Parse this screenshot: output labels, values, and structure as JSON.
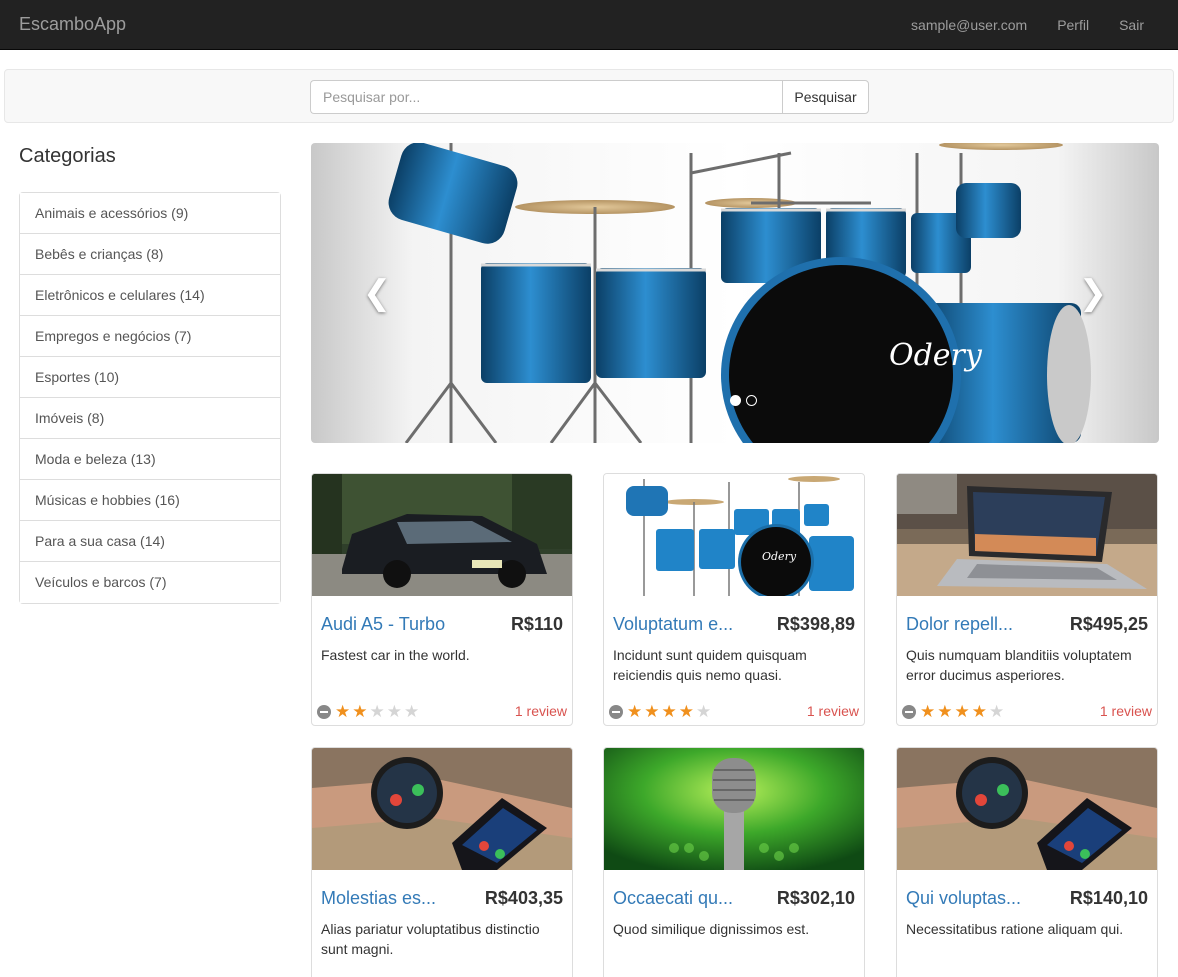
{
  "navbar": {
    "brand": "EscamboApp",
    "email": "sample@user.com",
    "profile": "Perfil",
    "logout": "Sair"
  },
  "search": {
    "placeholder": "Pesquisar por...",
    "value": "",
    "button": "Pesquisar"
  },
  "categories": {
    "title": "Categorias",
    "items": [
      {
        "label": "Animais e acessórios (9)"
      },
      {
        "label": "Bebês e crianças (8)"
      },
      {
        "label": "Eletrônicos e celulares (14)"
      },
      {
        "label": "Empregos e negócios (7)"
      },
      {
        "label": "Esportes (10)"
      },
      {
        "label": "Imóveis (8)"
      },
      {
        "label": "Moda e beleza (13)"
      },
      {
        "label": "Músicas e hobbies (16)"
      },
      {
        "label": "Para a sua casa (14)"
      },
      {
        "label": "Veículos e barcos (7)"
      }
    ]
  },
  "carousel": {
    "prev_icon": "chevron-left-icon",
    "next_icon": "chevron-right-icon",
    "slide_count": 2,
    "active_slide": 1,
    "brand_text": "Odery"
  },
  "products": [
    {
      "image": "car",
      "name": "Audi A5 - Turbo",
      "price": "R$110",
      "description": "Fastest car in the world.",
      "rating": 2,
      "reviews": "1 review"
    },
    {
      "image": "drums",
      "name": "Voluptatum e...",
      "price": "R$398,89",
      "description": "Incidunt sunt quidem quisquam reiciendis quis nemo quasi.",
      "rating": 4,
      "reviews": "1 review"
    },
    {
      "image": "laptop",
      "name": "Dolor repell...",
      "price": "R$495,25",
      "description": "Quis numquam blanditiis voluptatem error ducimus asperiores.",
      "rating": 4,
      "reviews": "1 review"
    },
    {
      "image": "watch",
      "name": "Molestias es...",
      "price": "R$403,35",
      "description": "Alias pariatur voluptatibus distinctio sunt magni."
    },
    {
      "image": "microphone",
      "name": "Occaecati qu...",
      "price": "R$302,10",
      "description": "Quod similique dignissimos est."
    },
    {
      "image": "watch",
      "name": "Qui voluptas...",
      "price": "R$140,10",
      "description": "Necessitatibus ratione aliquam qui."
    }
  ],
  "colors": {
    "navbar_bg": "#222222",
    "link": "#337ab7",
    "review": "#d9534f",
    "star": "#f0901d"
  }
}
